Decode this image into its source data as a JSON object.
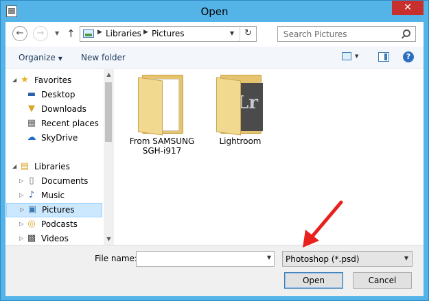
{
  "window": {
    "title": "Open",
    "close_label": "✕"
  },
  "navbar": {
    "back_icon": "back-arrow-icon",
    "forward_icon": "forward-arrow-icon",
    "up_icon": "up-arrow-icon",
    "breadcrumb": [
      "Libraries",
      "Pictures"
    ],
    "search_placeholder": "Search Pictures"
  },
  "toolbar": {
    "organize_label": "Organize",
    "new_folder_label": "New folder"
  },
  "nav_tree": {
    "favorites": {
      "label": "Favorites",
      "items": [
        "Desktop",
        "Downloads",
        "Recent places",
        "SkyDrive"
      ]
    },
    "libraries": {
      "label": "Libraries",
      "items": [
        "Documents",
        "Music",
        "Pictures",
        "Podcasts",
        "Videos"
      ],
      "selected": "Pictures"
    }
  },
  "content": {
    "folders": [
      {
        "label_line1": "From SAMSUNG",
        "label_line2": "SGH-i917"
      },
      {
        "label_line1": "Lightroom",
        "label_line2": "",
        "thumb_text": "Lr"
      }
    ]
  },
  "bottom": {
    "file_name_label": "File name:",
    "file_name_value": "",
    "file_type_value": "Photoshop (*.psd)",
    "open_label": "Open",
    "cancel_label": "Cancel"
  },
  "annotation": {
    "arrow_color": "#e8211d"
  },
  "colors": {
    "frame": "#54b4e8",
    "selection": "#cce8ff",
    "close_button": "#c7302c"
  }
}
